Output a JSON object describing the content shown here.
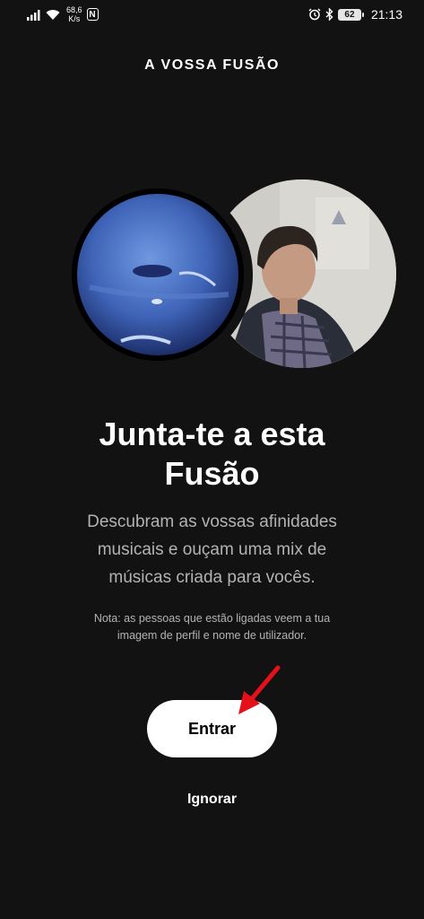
{
  "status_bar": {
    "net_speed_value": "68,6",
    "net_speed_unit": "K/s",
    "battery_level": "62",
    "time": "21:13",
    "icons": [
      "signal-icon",
      "wifi-icon",
      "nfc-icon",
      "alarm-icon",
      "bluetooth-icon",
      "battery-icon"
    ]
  },
  "header": {
    "title": "A VOSSA FUSÃO"
  },
  "content": {
    "heading_line1": "Junta-te a esta",
    "heading_line2": "Fusão",
    "description_line1": "Descubram as vossas afinidades",
    "description_line2": "musicais e ouçam uma mix de",
    "description_line3": "músicas criada para vocês.",
    "note_line1": "Nota: as pessoas que estão ligadas veem a tua",
    "note_line2": "imagem de perfil e nome de utilizador."
  },
  "actions": {
    "join_label": "Entrar",
    "skip_label": "Ignorar"
  },
  "colors": {
    "background": "#121212",
    "button": "#ffffff",
    "annotation_arrow": "#e4101a"
  }
}
